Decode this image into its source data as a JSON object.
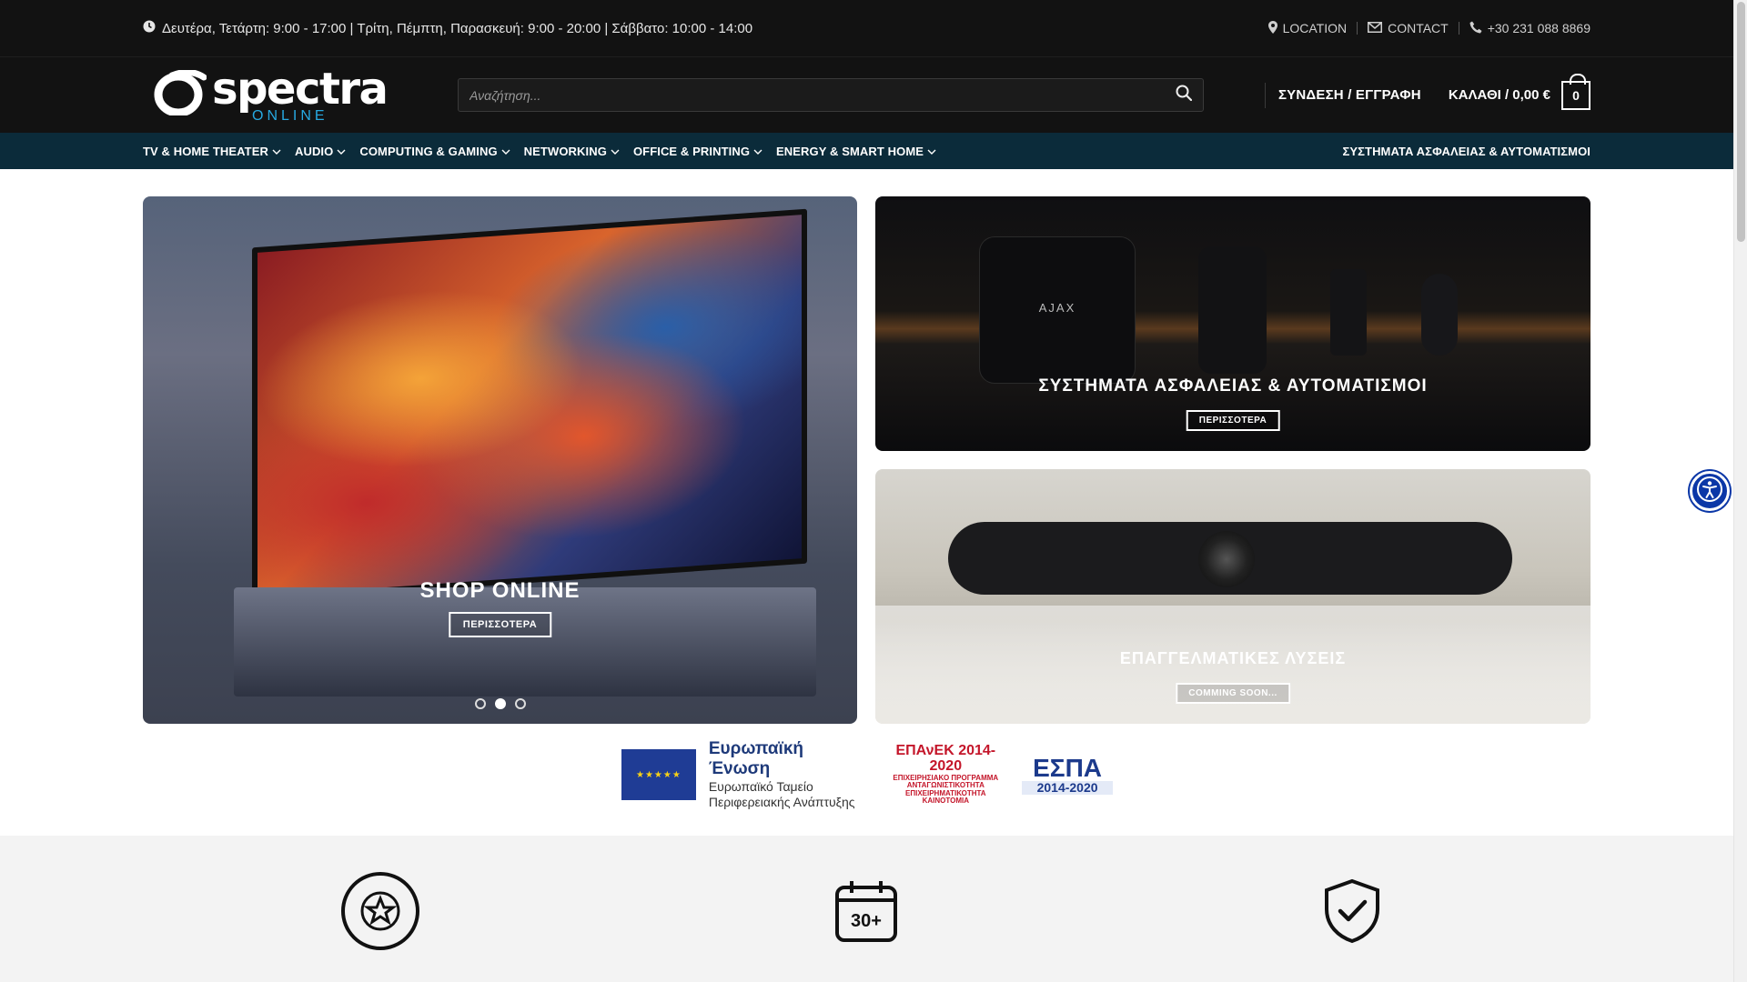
{
  "topbar": {
    "hours": "Δευτέρα, Τετάρτη: 9:00 - 17:00 | Τρίτη, Πέμπτη, Παρασκευή: 9:00 - 20:00 | Σάββατο: 10:00 - 14:00",
    "location": "LOCATION",
    "contact": "CONTACT",
    "phone": "+30 231 088 8869"
  },
  "header": {
    "logo_main": "spectra",
    "logo_sub": "ONLINE",
    "search_placeholder": "Αναζήτηση...",
    "login": "ΣΥΝΔΕΣΗ / ΕΓΓΡΑΦΗ",
    "cart_label": "ΚΑΛΑΘΙ / 0,00 €",
    "cart_count": "0"
  },
  "nav": {
    "items": [
      "TV & HOME THEATER",
      "AUDIO",
      "COMPUTING & GAMING",
      "NETWORKING",
      "OFFICE & PRINTING",
      "ENERGY & SMART HOME"
    ],
    "right": "ΣΥΣΤΗΜΑΤΑ ΑΣΦΑΛΕΙΑΣ & ΑΥΤΟΜΑΤΙΣΜΟΙ"
  },
  "banners": {
    "main": {
      "title": "SHOP ONLINE",
      "button": "ΠΕΡΙΣΣΟΤΕΡΑ",
      "slides": 3,
      "active_slide": 2
    },
    "security": {
      "brand": "AJAX",
      "title": "ΣΥΣΤΗΜΑΤΑ ΑΣΦΑΛΕΙΑΣ & ΑΥΤΟΜΑΤΙΣΜΟΙ",
      "button": "ΠΕΡΙΣΣΟΤΕΡΑ"
    },
    "business": {
      "title": "ΕΠΑΓΓΕΛΜΑΤΙΚΕΣ ΛΥΣΕΙΣ",
      "button": "COMMING SOON..."
    }
  },
  "funding": {
    "eu_title": "Ευρωπαϊκή Ένωση",
    "eu_line1": "Ευρωπαϊκό Ταμείο",
    "eu_line2": "Περιφερειακής Ανάπτυξης",
    "epanek_title": "ΕΠΑνΕΚ 2014-2020",
    "epanek_l1": "ΕΠΙΧΕΙΡΗΣΙΑΚΟ ΠΡΟΓΡΑΜΜΑ",
    "epanek_l2": "ΑΝΤΑΓΩΝΙΣΤΙΚΟΤΗΤΑ",
    "epanek_l3": "ΕΠΙΧΕΙΡΗΜΑΤΙΚΟΤΗΤΑ",
    "epanek_l4": "ΚΑΙΝΟΤΟΜΙΑ",
    "espa_title": "ΕΣΠΑ",
    "espa_years": "2014-2020"
  },
  "features": {
    "years_badge": "30+"
  },
  "colors": {
    "topbar_bg": "#121212",
    "nav_bg": "#0b2b3a",
    "logo_accent": "#27a9e1",
    "accessibility": "#0b37a7"
  }
}
